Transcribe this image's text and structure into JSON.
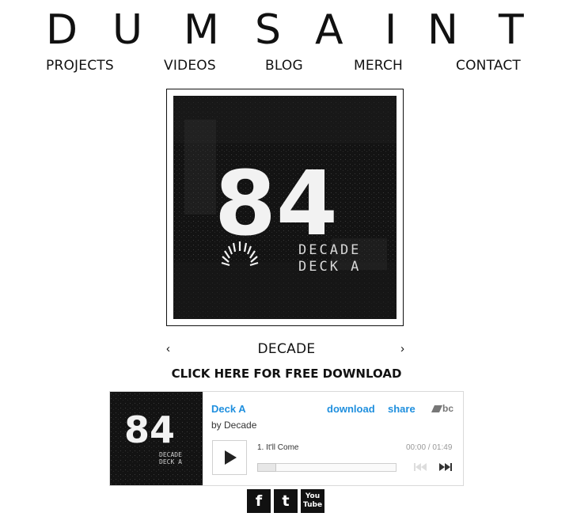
{
  "brand": {
    "letters": [
      "D",
      "U",
      "M",
      "S",
      "A",
      "I",
      "N",
      "T"
    ]
  },
  "nav": {
    "items": [
      "PROJECTS",
      "VIDEOS",
      "BLOG",
      "MERCH",
      "CONTACT"
    ]
  },
  "cover": {
    "numerals": "84",
    "text_line1": "DECADE",
    "text_line2": "DECK A"
  },
  "slider": {
    "title": "DECADE",
    "prev": "‹",
    "next": "›"
  },
  "download_cta": "CLICK HERE FOR FREE DOWNLOAD",
  "player": {
    "album": "Deck A",
    "artist": "by Decade",
    "download_label": "download",
    "share_label": "share",
    "logo_text": "bc",
    "track_title": "1.  It'll Come",
    "time": "00:00 / 01:49",
    "progress": 0,
    "accent_color": "#1f8fde"
  },
  "social": [
    {
      "label": "f",
      "icon": "facebook-icon"
    },
    {
      "label": "t",
      "icon": "twitter-icon"
    },
    {
      "label": "You Tube",
      "icon": "youtube-icon"
    }
  ]
}
